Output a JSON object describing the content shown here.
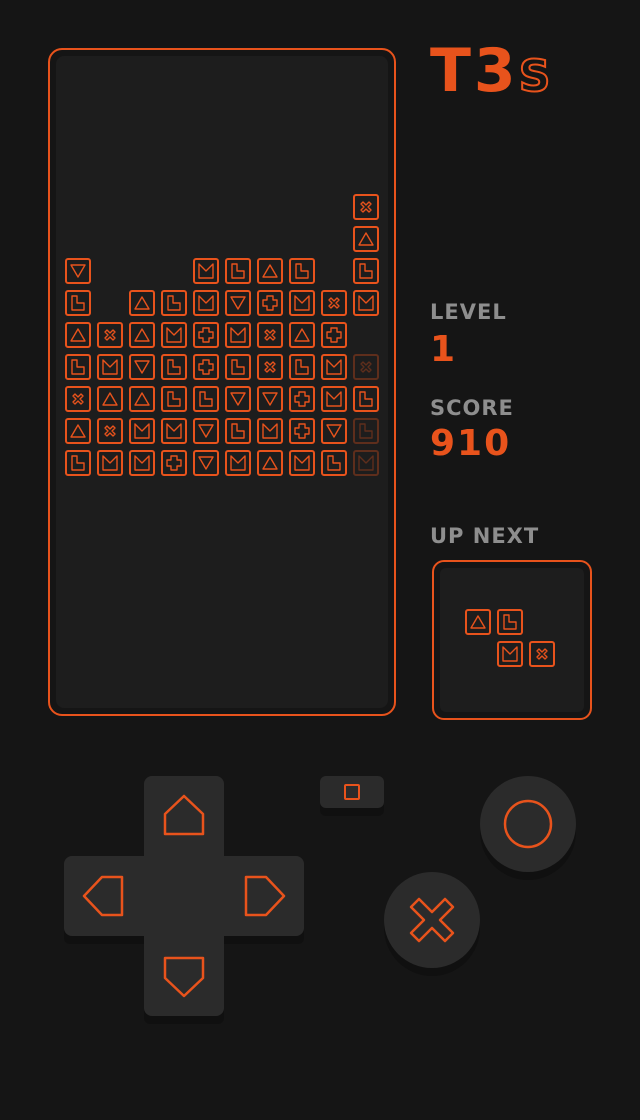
{
  "app": {
    "logo_main": "T3",
    "logo_sub": "S"
  },
  "stats": {
    "level_label": "LEVEL",
    "level_value": "1",
    "score_label": "SCORE",
    "score_value": "910",
    "next_label": "UP NEXT"
  },
  "colors": {
    "accent": "#e8531c",
    "background": "#151515",
    "panel": "#1d1d1d",
    "button": "#2b2b2b",
    "label": "#8e8e8e"
  },
  "board": {
    "columns": 10,
    "rows": 20,
    "falling_piece": [
      {
        "col": 9,
        "row": 4,
        "symbol": "x"
      },
      {
        "col": 9,
        "row": 5,
        "symbol": "tri-up"
      },
      {
        "col": 9,
        "row": 6,
        "symbol": "l"
      },
      {
        "col": 9,
        "row": 7,
        "symbol": "m"
      }
    ],
    "stack": [
      "v...mlul..",
      "l.ulmvpmx.",
      "uxumpmxup.",
      "lmvlplxlmX",
      "xuullvvpmlU",
      "uxmmvlmpvL",
      "lmmpvmumlM"
    ]
  },
  "next_piece": [
    {
      "col": 0,
      "row": 0,
      "symbol": "tri-up"
    },
    {
      "col": 1,
      "row": 0,
      "symbol": "l"
    },
    {
      "col": 1,
      "row": 1,
      "symbol": "m"
    },
    {
      "col": 2,
      "row": 1,
      "symbol": "x"
    }
  ],
  "controls": {
    "dpad": [
      "up",
      "left",
      "right",
      "down"
    ],
    "select_icon": "square-icon",
    "a_icon": "circle-icon",
    "b_icon": "cross-icon"
  }
}
